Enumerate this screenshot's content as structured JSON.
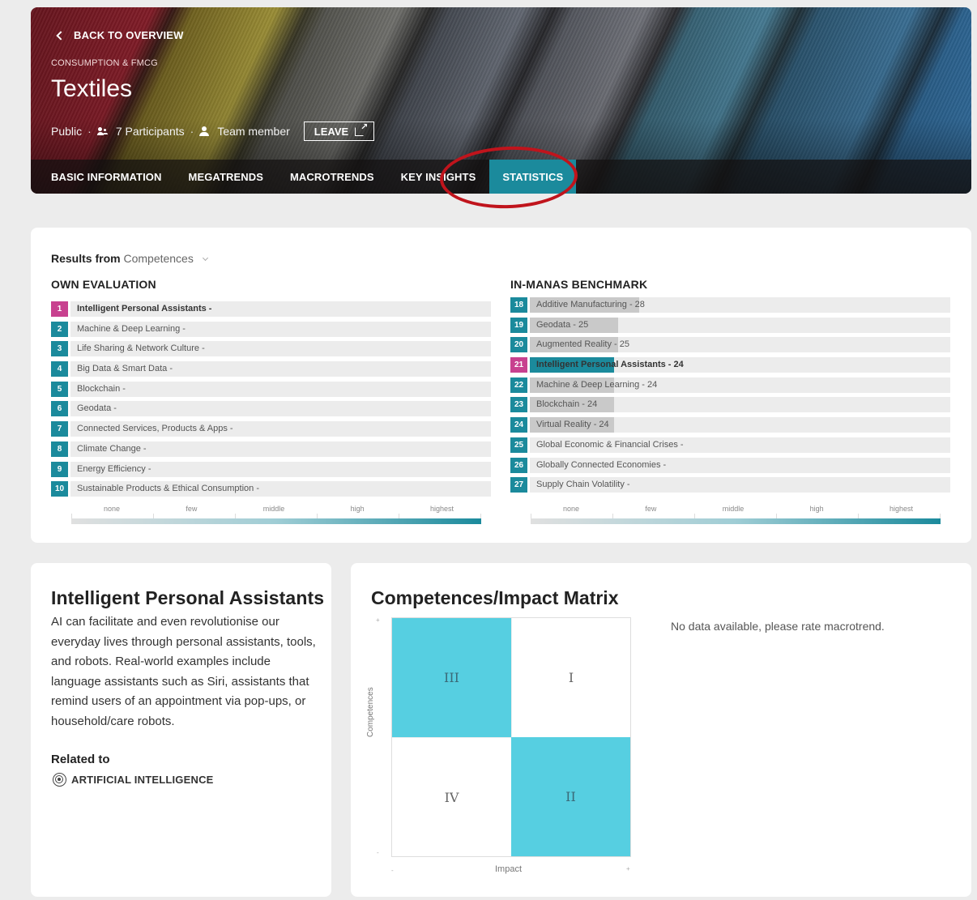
{
  "header": {
    "back_label": "BACK TO OVERVIEW",
    "category": "CONSUMPTION & FMCG",
    "title": "Textiles",
    "visibility": "Public",
    "participants": "7 Participants",
    "role": "Team member",
    "leave_label": "LEAVE",
    "tabs": [
      {
        "label": "BASIC INFORMATION"
      },
      {
        "label": "MEGATRENDS"
      },
      {
        "label": "MACROTRENDS"
      },
      {
        "label": "KEY INSIGHTS"
      },
      {
        "label": "STATISTICS",
        "active": true
      }
    ]
  },
  "results": {
    "from_label": "Results from",
    "from_value": "Competences",
    "own": {
      "title": "OWN EVALUATION",
      "items": [
        {
          "rank": "1",
          "label": "Intelligent Personal Assistants -",
          "score": 0,
          "highlight": true
        },
        {
          "rank": "2",
          "label": "Machine & Deep Learning -",
          "score": 0
        },
        {
          "rank": "3",
          "label": "Life Sharing & Network Culture -",
          "score": 0
        },
        {
          "rank": "4",
          "label": "Big Data & Smart Data -",
          "score": 0
        },
        {
          "rank": "5",
          "label": "Blockchain -",
          "score": 0
        },
        {
          "rank": "6",
          "label": "Geodata -",
          "score": 0
        },
        {
          "rank": "7",
          "label": "Connected Services, Products & Apps -",
          "score": 0
        },
        {
          "rank": "8",
          "label": "Climate Change -",
          "score": 0
        },
        {
          "rank": "9",
          "label": "Energy Efficiency -",
          "score": 0
        },
        {
          "rank": "10",
          "label": "Sustainable Products & Ethical Consumption -",
          "score": 0
        }
      ]
    },
    "benchmark": {
      "title": "IN-MANAS BENCHMARK",
      "items": [
        {
          "rank": "18",
          "label": "Additive Manufacturing - 28",
          "score": 0.26
        },
        {
          "rank": "19",
          "label": "Geodata - 25",
          "score": 0.21
        },
        {
          "rank": "20",
          "label": "Augmented Reality - 25",
          "score": 0.21
        },
        {
          "rank": "21",
          "label": "Intelligent Personal Assistants - 24",
          "score": 0.2,
          "highlight": true
        },
        {
          "rank": "22",
          "label": "Machine & Deep Learning - 24",
          "score": 0.2
        },
        {
          "rank": "23",
          "label": "Blockchain - 24",
          "score": 0.2
        },
        {
          "rank": "24",
          "label": "Virtual Reality - 24",
          "score": 0.2
        },
        {
          "rank": "25",
          "label": "Global Economic & Financial Crises -",
          "score": 0
        },
        {
          "rank": "26",
          "label": "Globally Connected Economies -",
          "score": 0
        },
        {
          "rank": "27",
          "label": "Supply Chain Volatility -",
          "score": 0
        }
      ]
    },
    "scale": [
      "none",
      "few",
      "middle",
      "high",
      "highest"
    ]
  },
  "trend": {
    "title": "Intelligent Personal Assistants",
    "description": "AI can facilitate and even revolutionise our everyday lives through personal assistants, tools, and robots. Real-world examples include language assistants such as Siri, assistants that remind users of an appointment via pop-ups, or household/care robots.",
    "related_label": "Related to",
    "related_item": "ARTIFICIAL INTELLIGENCE"
  },
  "matrix": {
    "title": "Competences/Impact Matrix",
    "quadrants": {
      "tl": "III",
      "tr": "I",
      "bl": "IV",
      "br": "II"
    },
    "y_label": "Competences",
    "x_label": "Impact",
    "y_plus": "+",
    "y_minus": "-",
    "x_minus": "-",
    "x_plus": "+",
    "no_data": "No data available, please rate macrotrend."
  },
  "colors": {
    "accent": "#1b8a9c",
    "highlight": "#c8418f",
    "matrix_cyan": "#56cfe1",
    "annotation": "#c0141c"
  }
}
